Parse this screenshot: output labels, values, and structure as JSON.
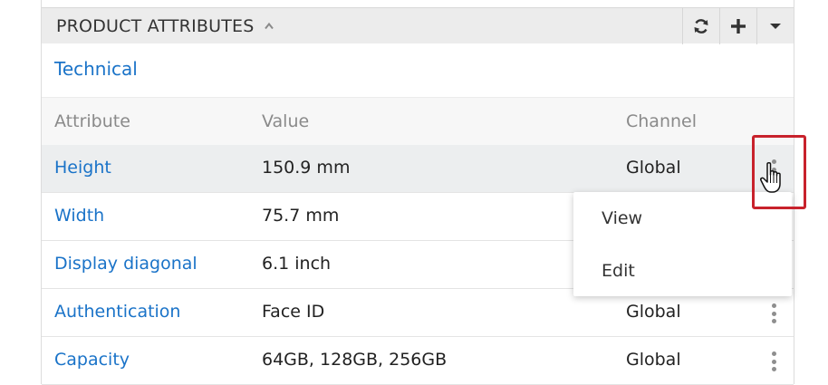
{
  "panel": {
    "title": "PRODUCT ATTRIBUTES",
    "section": "Technical",
    "buttons": [
      "refresh-icon",
      "plus-icon",
      "caret-down-icon"
    ]
  },
  "table": {
    "headers": {
      "attribute": "Attribute",
      "value": "Value",
      "channel": "Channel"
    },
    "rows": [
      {
        "attribute": "Height",
        "value": "150.9 mm",
        "channel": "Global"
      },
      {
        "attribute": "Width",
        "value": "75.7 mm",
        "channel": ""
      },
      {
        "attribute": "Display diagonal",
        "value": "6.1 inch",
        "channel": ""
      },
      {
        "attribute": "Authentication",
        "value": "Face ID",
        "channel": "Global"
      },
      {
        "attribute": "Capacity",
        "value": "64GB, 128GB, 256GB",
        "channel": "Global"
      }
    ]
  },
  "context_menu": {
    "items": [
      "View",
      "Edit"
    ]
  },
  "colors": {
    "link": "#1a73c8",
    "highlight": "#c8222c",
    "header_bg": "#ececec",
    "row_hover": "#eceeef"
  }
}
